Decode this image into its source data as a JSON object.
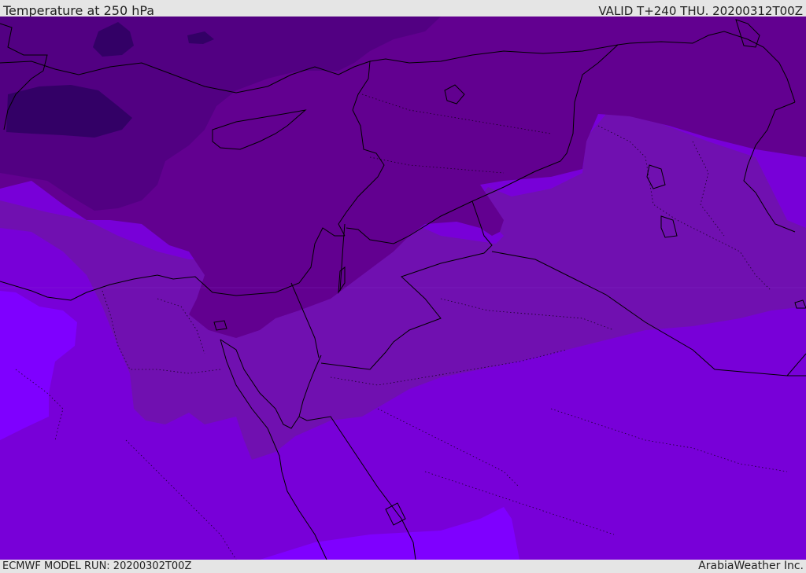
{
  "header": {
    "title": "Temperature at 250 hPa",
    "valid": "VALID T+240 THU. 20200312T00Z"
  },
  "footer": {
    "model_run": "ECMWF MODEL RUN: 20200302T00Z",
    "credit": "ArabiaWeather Inc."
  },
  "map": {
    "colors": {
      "band_darkest": "#330066",
      "band_dark": "#520082",
      "band_mid": "#620090",
      "band_light": "#7010b0",
      "band_bright": "#7800d8",
      "band_brightest": "#7f00ff",
      "coastline": "#000000"
    }
  }
}
